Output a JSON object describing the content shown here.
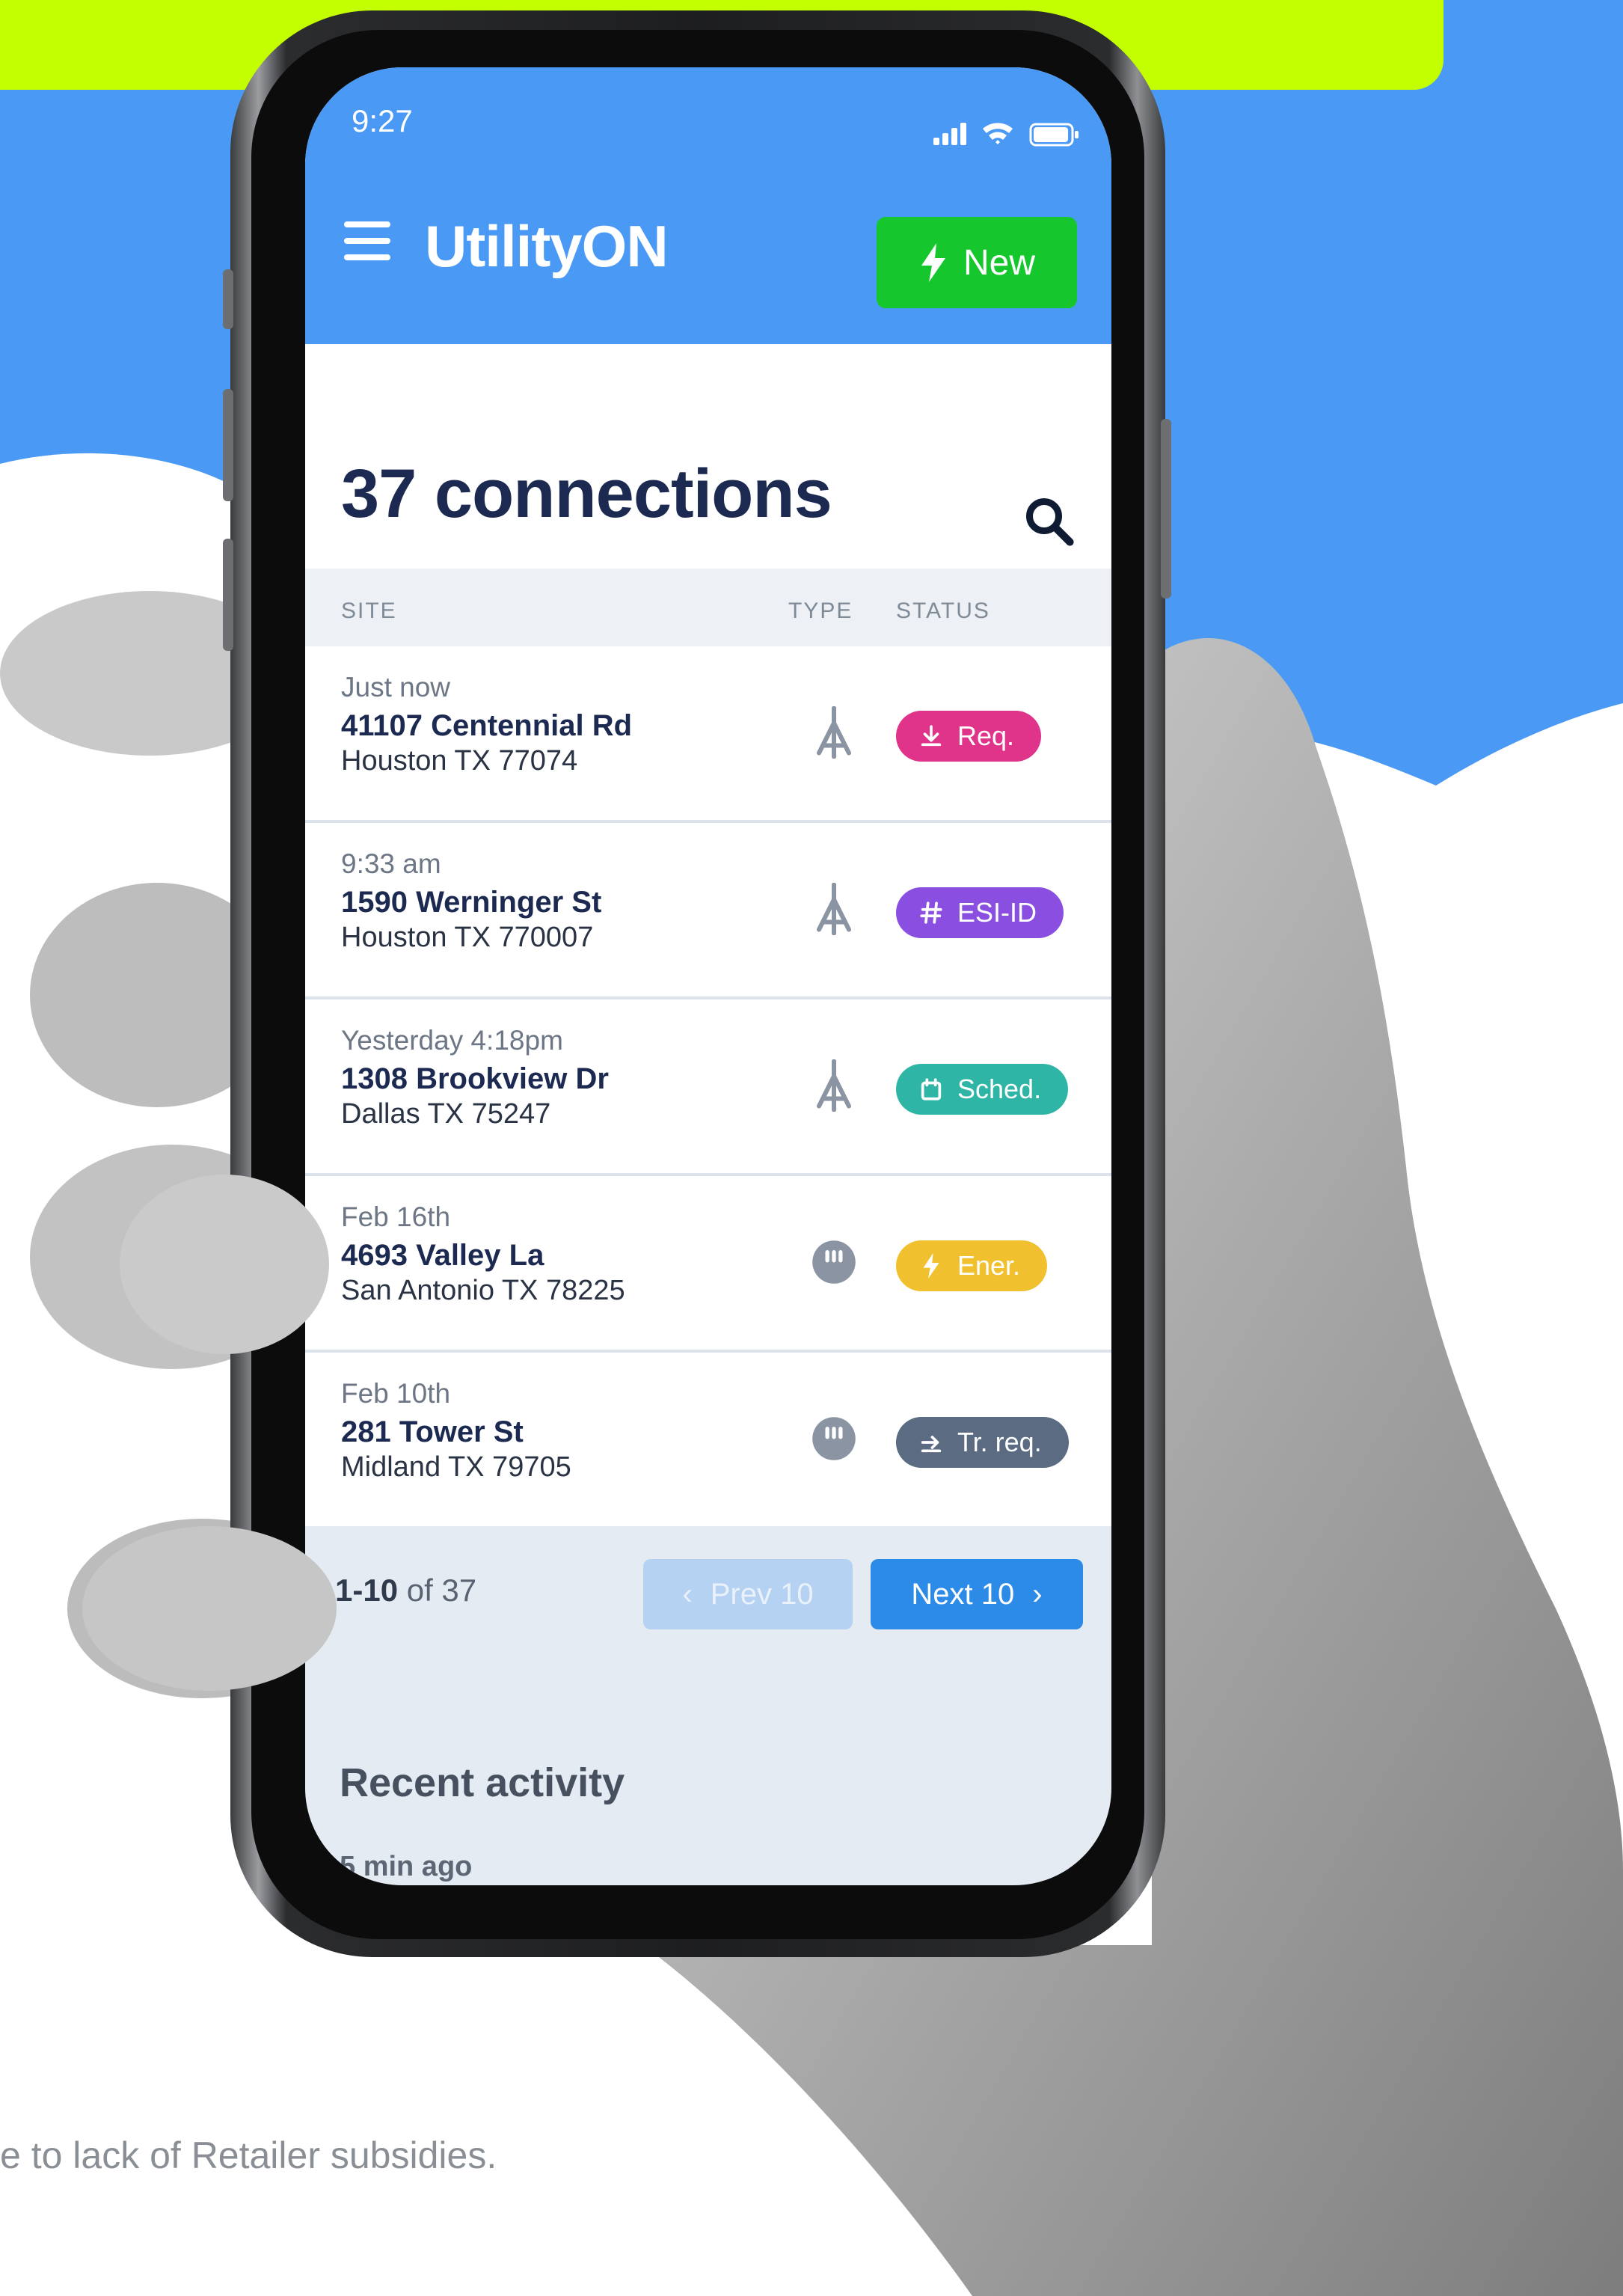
{
  "status_bar": {
    "time": "9:27"
  },
  "header": {
    "logo": "UtilityON",
    "new_label": "New"
  },
  "main": {
    "title": "37 connections"
  },
  "table": {
    "columns": [
      "SITE",
      "TYPE",
      "STATUS"
    ],
    "rows": [
      {
        "when": "Just now",
        "address": "41107 Centennial Rd",
        "city": "Houston TX 77074",
        "type": "electric-pole-icon",
        "status": "Req.",
        "status_color": "#e0338a",
        "status_icon": "download-icon"
      },
      {
        "when": "9:33 am",
        "address": "1590 Werninger St",
        "city": "Houston TX 770007",
        "type": "electric-pole-icon",
        "status": "ESI-ID",
        "status_color": "#8a4fe0",
        "status_icon": "hash-icon"
      },
      {
        "when": "Yesterday 4:18pm",
        "address": "1308 Brookview Dr",
        "city": "Dallas TX 75247",
        "type": "electric-pole-icon",
        "status": "Sched.",
        "status_color": "#2fb5a6",
        "status_icon": "calendar-icon"
      },
      {
        "when": "Feb 16th",
        "address": "4693 Valley La",
        "city": "San Antonio TX 78225",
        "type": "meter-icon",
        "status": "Ener.",
        "status_color": "#f0c02e",
        "status_icon": "bolt-icon"
      },
      {
        "when": "Feb 10th",
        "address": "281 Tower St",
        "city": "Midland TX 79705",
        "type": "meter-icon",
        "status": "Tr. req.",
        "status_color": "#5b6b82",
        "status_icon": "transfer-icon"
      }
    ]
  },
  "pagination": {
    "range": "1-10",
    "of": "of 37",
    "prev_label": "Prev 10",
    "next_label": "Next 10"
  },
  "recent": {
    "title": "Recent activity",
    "first_time": "5 min ago"
  },
  "footnote": "e to lack of Retailer subsidies.",
  "colors": {
    "header_blue": "#4a9af5",
    "banner_lime": "#c3ff00",
    "new_green": "#15c72c",
    "title_navy": "#1c2a52"
  }
}
